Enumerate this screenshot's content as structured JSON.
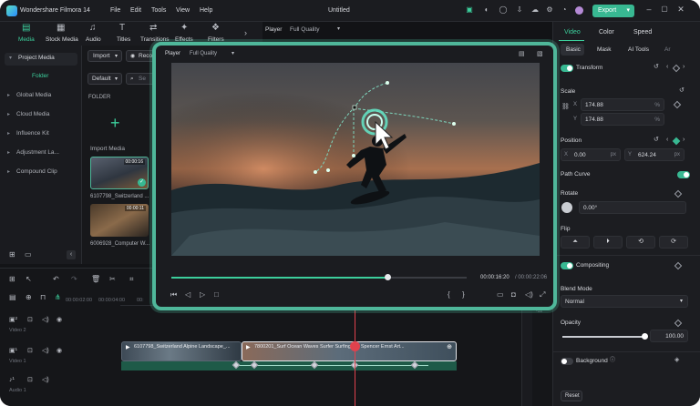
{
  "app": {
    "name": "Wondershare Filmora 14",
    "project": "Untitled"
  },
  "menu": [
    "File",
    "Edit",
    "Tools",
    "View",
    "Help"
  ],
  "export_label": "Export",
  "toolbar_tabs": [
    {
      "label": "Media",
      "icon": "media-icon"
    },
    {
      "label": "Stock Media",
      "icon": "stock-media-icon"
    },
    {
      "label": "Audio",
      "icon": "audio-icon"
    },
    {
      "label": "Titles",
      "icon": "titles-icon"
    },
    {
      "label": "Transitions",
      "icon": "transitions-icon"
    },
    {
      "label": "Effects",
      "icon": "effects-icon"
    },
    {
      "label": "Filters",
      "icon": "filters-icon"
    }
  ],
  "sidebar": {
    "items": [
      {
        "label": "Project Media"
      },
      {
        "label": "Folder"
      },
      {
        "label": "Global Media"
      },
      {
        "label": "Cloud Media"
      },
      {
        "label": "Influence Kit"
      },
      {
        "label": "Adjustment La..."
      },
      {
        "label": "Compound Clip"
      }
    ]
  },
  "media": {
    "import_label": "Import",
    "record_label": "Record",
    "sort_label": "Default",
    "search_placeholder": "Se",
    "folder_heading": "FOLDER",
    "import_media_label": "Import Media",
    "items": [
      {
        "name": "6107798_Switzerland ...",
        "duration": "00:00:16"
      },
      {
        "name": "6006928_Computer W...",
        "duration": "00:00:11"
      }
    ]
  },
  "player": {
    "label": "Player",
    "quality": "Full Quality",
    "current_time": "00:00:16:20",
    "total_time": "/ 00:00:22:06",
    "progress": 0.73
  },
  "right": {
    "tabs": [
      "Video",
      "Color",
      "Speed"
    ],
    "subtabs": [
      "Basic",
      "Mask",
      "AI Tools",
      "Ar"
    ],
    "transform_label": "Transform",
    "scale_label": "Scale",
    "scale_x_label": "X",
    "scale_x": "174.88",
    "scale_y_label": "Y",
    "scale_y": "174.88",
    "percent": "%",
    "position_label": "Position",
    "pos_x_label": "X",
    "pos_x": "0.00",
    "pos_y_label": "Y",
    "pos_y": "624.24",
    "px": "px",
    "path_curve_label": "Path Curve",
    "rotate_label": "Rotate",
    "rotate_value": "0.00°",
    "flip_label": "Flip",
    "compositing_label": "Compositing",
    "blend_mode_label": "Blend Mode",
    "blend_mode_value": "Normal",
    "opacity_label": "Opacity",
    "opacity_value": "100.00",
    "opacity_level": 1.0,
    "background_label": "Background",
    "reset_label": "Reset"
  },
  "timeline": {
    "ruler": [
      "00:00:02:00",
      "00:00:04:00",
      "00:"
    ],
    "tracks": [
      {
        "label": "Video 2"
      },
      {
        "label": "Video 1"
      },
      {
        "label": "Audio 1"
      }
    ],
    "clips": [
      {
        "title": "6107798_Switzerland Alpine Landscape_..."
      },
      {
        "title": "7800201_Surf Ocean Waves Surfer Surfing_By Spencer Ernst Art..."
      }
    ]
  },
  "colors": {
    "accent": "#38b892",
    "overlay_border": "#4fb79a",
    "playhead": "#e0424d"
  }
}
